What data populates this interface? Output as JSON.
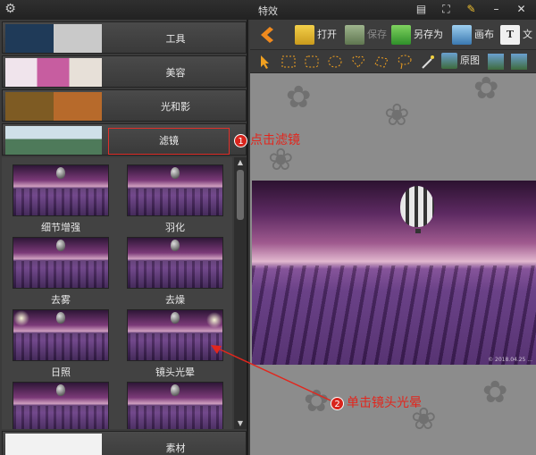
{
  "window": {
    "title": "特效"
  },
  "categories": {
    "tools": "工具",
    "beauty": "美容",
    "light_shadow": "光和影",
    "filter": "滤镜",
    "material": "素材"
  },
  "filters": [
    {
      "label": "细节增强"
    },
    {
      "label": "羽化"
    },
    {
      "label": "去雾"
    },
    {
      "label": "去燥"
    },
    {
      "label": "日照"
    },
    {
      "label": "镜头光晕"
    },
    {
      "label": ""
    },
    {
      "label": ""
    }
  ],
  "toolbar": {
    "open": "打开",
    "save": "保存",
    "save_as": "另存为",
    "canvas": "画布",
    "text": "文"
  },
  "toolbar2": {
    "original": "原图"
  },
  "photo": {
    "credit": "© 2018.04.25 ..."
  },
  "annotations": {
    "step1_num": "1",
    "step1_text": "点击滤镜",
    "step2_num": "2",
    "step2_text": "单击镜头光晕"
  },
  "colors": {
    "accent_red": "#e2261d",
    "background": "#3a3a3a"
  }
}
